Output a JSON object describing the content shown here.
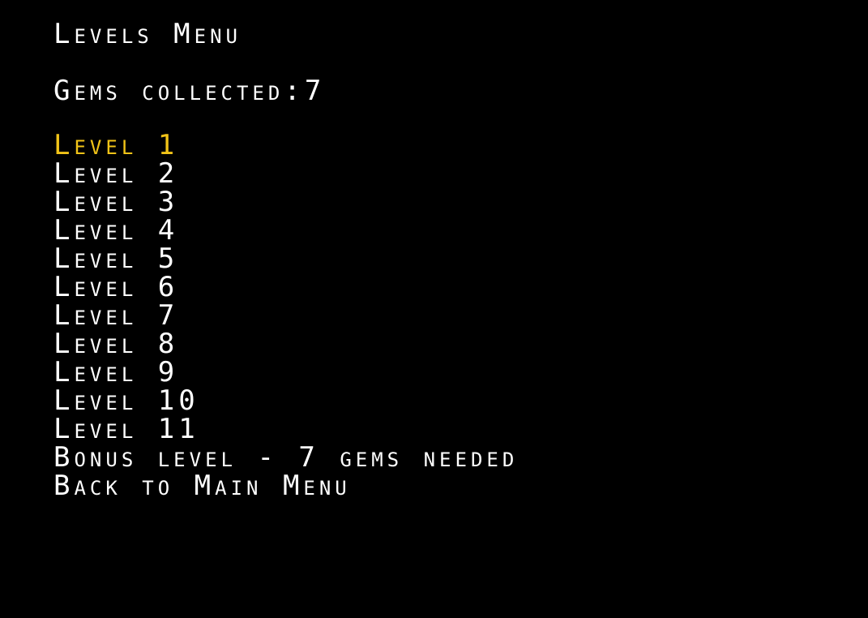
{
  "screen_title": "Levels Menu",
  "gems_collected": {
    "label": "Gems collected:",
    "value": "7"
  },
  "menu": {
    "items": [
      {
        "label": "Level 1",
        "selected": true
      },
      {
        "label": "Level 2",
        "selected": false
      },
      {
        "label": "Level 3",
        "selected": false
      },
      {
        "label": "Level 4",
        "selected": false
      },
      {
        "label": "Level 5",
        "selected": false
      },
      {
        "label": "Level 6",
        "selected": false
      },
      {
        "label": "Level 7",
        "selected": false
      },
      {
        "label": "Level 8",
        "selected": false
      },
      {
        "label": "Level 9",
        "selected": false
      },
      {
        "label": "Level 10",
        "selected": false
      },
      {
        "label": "Level 11",
        "selected": false
      },
      {
        "label": "Bonus level - 7 gems needed",
        "selected": false
      },
      {
        "label": "Back to Main Menu",
        "selected": false
      }
    ]
  },
  "colors": {
    "background": "#000000",
    "text": "#ffffff",
    "selected": "#f2c418"
  }
}
